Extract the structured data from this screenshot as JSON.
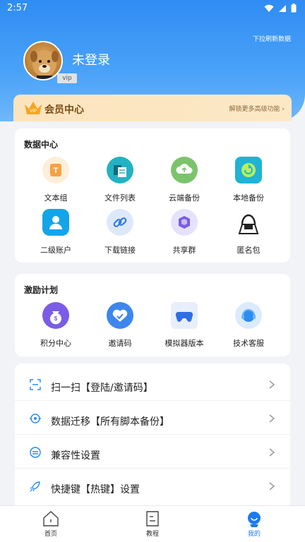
{
  "status": {
    "time": "2:57"
  },
  "header": {
    "refresh_hint": "下拉刷新数据",
    "username": "未登录",
    "vip_tag": "vip"
  },
  "vip_bar": {
    "title": "会员中心",
    "more": "解锁更多高级功能 ›",
    "crown_badge": "VIP"
  },
  "data_center": {
    "title": "数据中心",
    "items": [
      {
        "label": "文本组",
        "icon": "text-group-icon"
      },
      {
        "label": "文件列表",
        "icon": "file-list-icon"
      },
      {
        "label": "云端备份",
        "icon": "cloud-backup-icon"
      },
      {
        "label": "本地备份",
        "icon": "local-backup-icon"
      },
      {
        "label": "二级账户",
        "icon": "sub-account-icon"
      },
      {
        "label": "下载链接",
        "icon": "link-icon"
      },
      {
        "label": "共享群",
        "icon": "share-group-icon"
      },
      {
        "label": "匿名包",
        "icon": "anonymous-icon"
      }
    ]
  },
  "incentive": {
    "title": "激励计划",
    "items": [
      {
        "label": "积分中心",
        "icon": "points-icon"
      },
      {
        "label": "邀请码",
        "icon": "invite-code-icon"
      },
      {
        "label": "模拟器版本",
        "icon": "gamepad-icon"
      },
      {
        "label": "技术客服",
        "icon": "support-icon"
      }
    ]
  },
  "menu": [
    {
      "label": "扫一扫【登陆/邀请码】",
      "icon": "scan-icon"
    },
    {
      "label": "数据迁移【所有脚本备份】",
      "icon": "migrate-icon"
    },
    {
      "label": "兼容性设置",
      "icon": "compat-icon"
    },
    {
      "label": "快捷键【热键】设置",
      "icon": "rocket-icon"
    }
  ],
  "tabs": [
    {
      "label": "首页",
      "icon": "home-icon"
    },
    {
      "label": "教程",
      "icon": "tutorial-icon"
    },
    {
      "label": "我的",
      "icon": "profile-icon",
      "active": true
    }
  ],
  "colors": {
    "accent": "#1c7bf0",
    "header": "#2f8cf2",
    "vip_text": "#7a4a14"
  }
}
